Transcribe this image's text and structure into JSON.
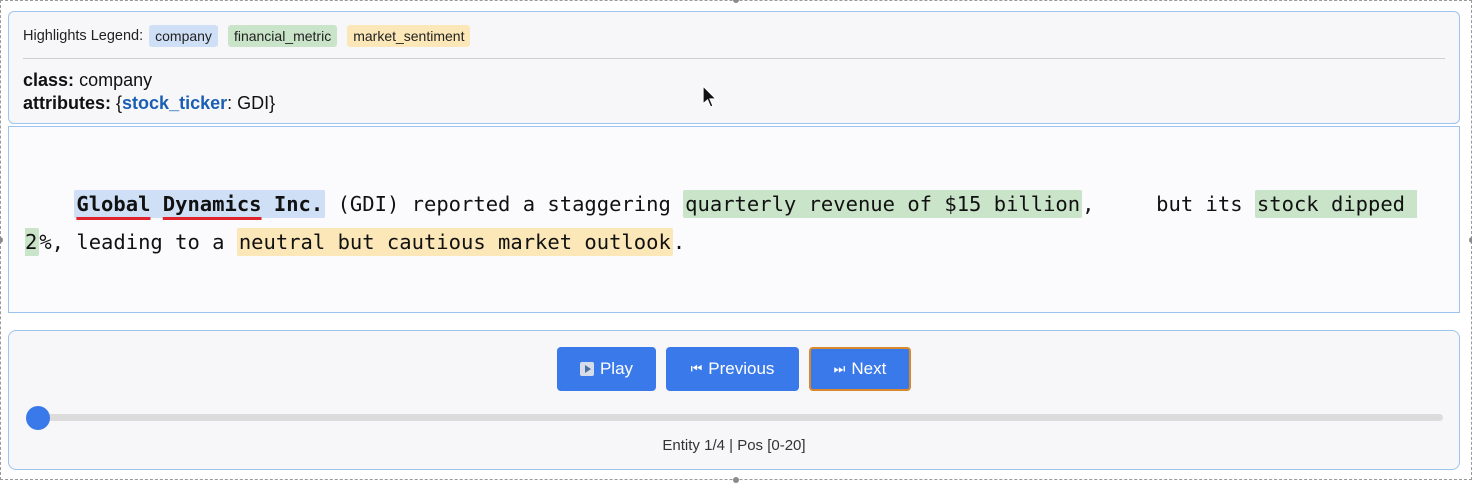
{
  "legend": {
    "label": "Highlights Legend:",
    "items": [
      "company",
      "financial_metric",
      "market_sentiment"
    ]
  },
  "entity": {
    "class_label": "class:",
    "class_value": "company",
    "attributes_label": "attributes:",
    "attr_open": "{",
    "attr_key": "stock_ticker",
    "attr_sep": ": ",
    "attr_value": "GDI",
    "attr_close": "}"
  },
  "text": {
    "indent": "    ",
    "entity1a": "Global",
    "space1": " ",
    "entity1b": "Dynamics",
    "space2": " ",
    "entity1c": "Inc.",
    "seg1": " (GDI) reported a staggering ",
    "entity2": "quarterly revenue of $15 billion",
    "seg2": ",     but its ",
    "entity3": "stock dipped 2",
    "seg3": "%, leading to a ",
    "entity4": "neutral but cautious market outlook",
    "seg4": "."
  },
  "controls": {
    "play_label": "Play",
    "prev_label": "Previous",
    "next_label": "Next",
    "prev_icon": "⏮",
    "next_icon": "⏭",
    "slider_value": 0
  },
  "status": "Entity 1/4 | Pos [0-20]",
  "colors": {
    "accent": "#3a79ea",
    "company": "#cfe0f6",
    "financial_metric": "#c9e4c8",
    "market_sentiment": "#fbe7b8"
  }
}
